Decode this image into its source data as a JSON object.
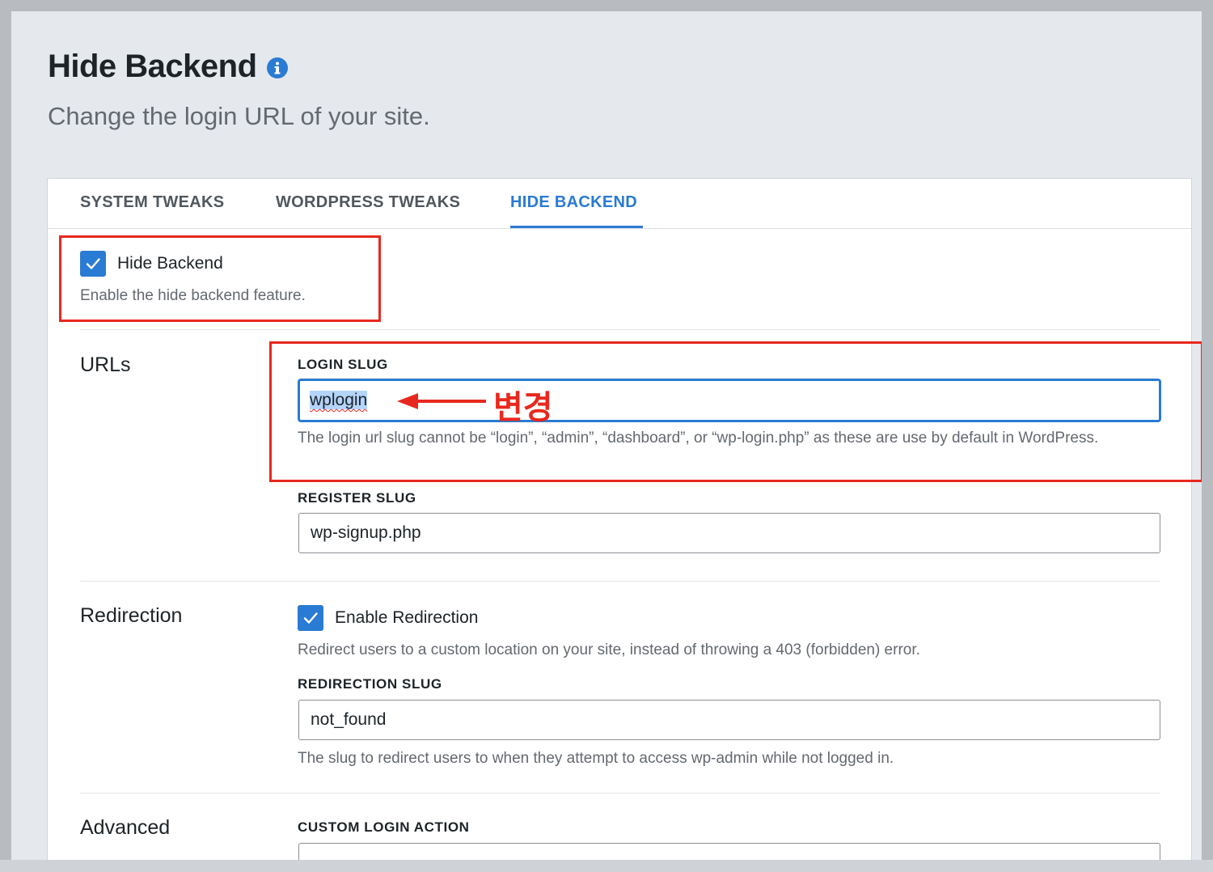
{
  "header": {
    "title": "Hide Backend",
    "subtitle": "Change the login URL of your site."
  },
  "tabs": [
    {
      "label": "SYSTEM TWEAKS",
      "active": false
    },
    {
      "label": "WORDPRESS TWEAKS",
      "active": false
    },
    {
      "label": "HIDE BACKEND",
      "active": true
    }
  ],
  "hide_backend": {
    "label": "Hide Backend",
    "checked": true,
    "help": "Enable the hide backend feature."
  },
  "urls": {
    "section_label": "URLs",
    "login_slug": {
      "label": "LOGIN SLUG",
      "value": "wplogin",
      "help": "The login url slug cannot be “login”, “admin”, “dashboard”, or “wp-login.php” as these are use by default in WordPress."
    },
    "register_slug": {
      "label": "REGISTER SLUG",
      "value": "wp-signup.php"
    }
  },
  "redirection": {
    "section_label": "Redirection",
    "enable_label": "Enable Redirection",
    "checked": true,
    "enable_help": "Redirect users to a custom location on your site, instead of throwing a 403 (forbidden) error.",
    "slug_label": "REDIRECTION SLUG",
    "slug_value": "not_found",
    "slug_help": "The slug to redirect users to when they attempt to access wp-admin while not logged in."
  },
  "advanced": {
    "section_label": "Advanced",
    "custom_login_action_label": "CUSTOM LOGIN ACTION",
    "custom_login_action_value": ""
  },
  "annotation": {
    "text": "변경",
    "color": "#e8281e"
  },
  "colors": {
    "accent": "#2a7bd3",
    "annotation_red": "#e8281e"
  }
}
